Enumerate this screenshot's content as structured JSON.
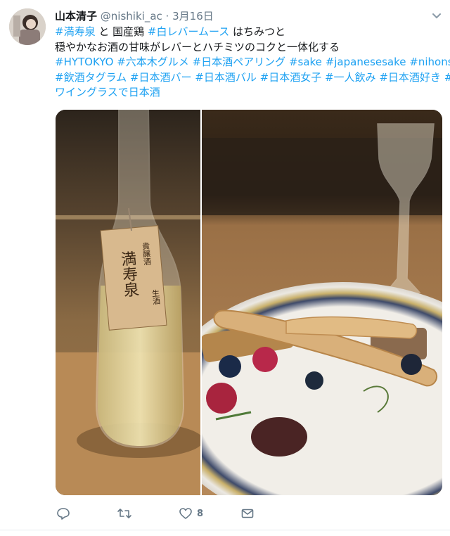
{
  "tweet": {
    "author_name": "山本清子",
    "handle": "@nishiki_ac",
    "separator": "·",
    "date": "3月16日",
    "lines": [
      [
        {
          "t": "#満寿泉",
          "tag": true
        },
        {
          "t": " と 国産鶏 ",
          "tag": false
        },
        {
          "t": "#白レバームース",
          "tag": true
        },
        {
          "t": " はちみつと",
          "tag": false
        }
      ],
      [
        {
          "t": "穏やかなお酒の甘味がレバーとハチミツのコクと一体化する",
          "tag": false
        }
      ],
      [
        {
          "t": "#HYTOKYO",
          "tag": true
        },
        {
          "t": " ",
          "tag": false
        },
        {
          "t": "#六本木グルメ",
          "tag": true
        },
        {
          "t": " ",
          "tag": false
        },
        {
          "t": "#日本酒ペアリング",
          "tag": true
        },
        {
          "t": " ",
          "tag": false
        },
        {
          "t": "#sake",
          "tag": true
        },
        {
          "t": " ",
          "tag": false
        },
        {
          "t": "#japanesesake",
          "tag": true
        },
        {
          "t": " ",
          "tag": false
        },
        {
          "t": "#nihonshu",
          "tag": true
        }
      ],
      [
        {
          "t": "#飲酒タグラム",
          "tag": true
        },
        {
          "t": " ",
          "tag": false
        },
        {
          "t": "#日本酒バー",
          "tag": true
        },
        {
          "t": " ",
          "tag": false
        },
        {
          "t": "#日本酒バル",
          "tag": true
        },
        {
          "t": " ",
          "tag": false
        },
        {
          "t": "#日本酒女子",
          "tag": true
        },
        {
          "t": " ",
          "tag": false
        },
        {
          "t": "#一人飲み",
          "tag": true
        },
        {
          "t": " ",
          "tag": false
        },
        {
          "t": "#日本酒好き",
          "tag": true
        },
        {
          "t": " ",
          "tag": false
        },
        {
          "t": "#",
          "tag": true
        }
      ],
      [
        {
          "t": "ワイングラスで日本酒",
          "tag": true
        }
      ]
    ]
  },
  "media": {
    "left_photo": {
      "bottle_tag_text": [
        "貴醸酒",
        "満寿泉",
        "生酒"
      ]
    },
    "right_photo": {}
  },
  "actions": {
    "reply_icon": "reply-icon",
    "retweet_icon": "retweet-icon",
    "like_icon": "heart-icon",
    "like_count": "8",
    "dm_icon": "envelope-icon"
  },
  "colors": {
    "link": "#1da1f2",
    "secondary": "#657786",
    "text": "#14171a"
  }
}
